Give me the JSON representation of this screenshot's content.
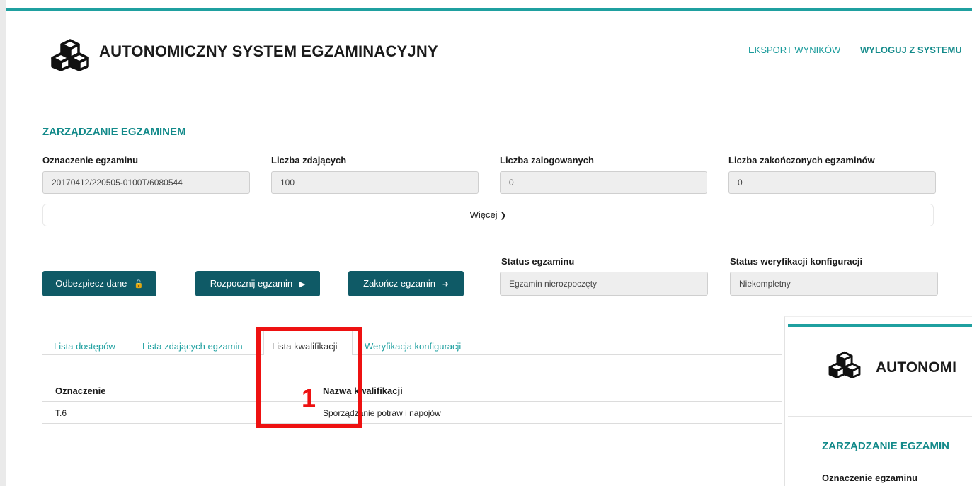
{
  "app": {
    "title": "AUTONOMICZNY SYSTEM EGZAMINACYJNY",
    "accent_color": "#1fa0a0",
    "primary_button_color": "#0f5a66"
  },
  "nav": {
    "export": "EKSPORT WYNIKÓW",
    "logout": "WYLOGUJ Z SYSTEMU"
  },
  "section": {
    "title": "ZARZĄDZANIE EGZAMINEM"
  },
  "fields": [
    {
      "label": "Oznaczenie egzaminu",
      "value": "20170412/220505-0100T/6080544"
    },
    {
      "label": "Liczba zdających",
      "value": "100"
    },
    {
      "label": "Liczba zalogowanych",
      "value": "0"
    },
    {
      "label": "Liczba zakończonych egzaminów",
      "value": "0"
    }
  ],
  "more": {
    "label": "Więcej"
  },
  "buttons": {
    "unlock": "Odbezpiecz dane",
    "start": "Rozpocznij egzamin",
    "finish": "Zakończ egzamin"
  },
  "status": {
    "exam_label": "Status egzaminu",
    "exam_value": "Egzamin nierozpoczęty",
    "config_label": "Status weryfikacji konfiguracji",
    "config_value": "Niekompletny"
  },
  "tabs": [
    {
      "label": "Lista dostępów"
    },
    {
      "label": "Lista zdających egzamin"
    },
    {
      "label": "Lista kwalifikacji"
    },
    {
      "label": "Weryfikacja konfiguracji"
    }
  ],
  "table": {
    "columns": [
      "Oznaczenie",
      "Nazwa kwalifikacji"
    ],
    "rows": [
      [
        "T.6",
        "Sporządzanie potraw i napojów"
      ]
    ]
  },
  "annotation": {
    "number": "1",
    "color": "#ee1111"
  },
  "inset": {
    "title": "AUTONOMI",
    "section": "ZARZĄDZANIE EGZAMIN",
    "field_label": "Oznaczenie egzaminu"
  }
}
